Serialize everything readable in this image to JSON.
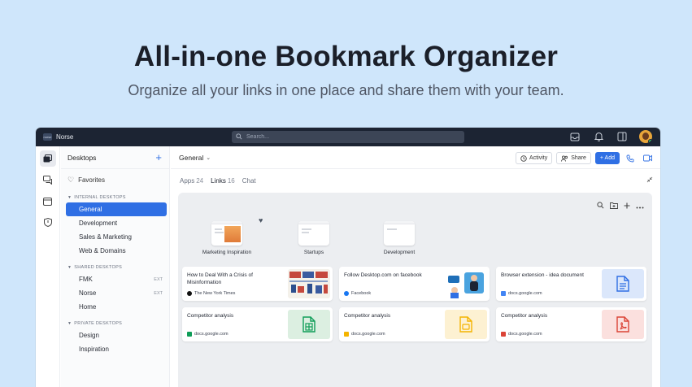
{
  "hero": {
    "title": "All-in-one Bookmark Organizer",
    "subtitle": "Organize all your links in one place and share them with your team."
  },
  "topbar": {
    "brand_logo": "norse",
    "brand": "Norse",
    "search_placeholder": "Search...",
    "icons": [
      "inbox-icon",
      "bell-icon",
      "panel-icon",
      "avatar"
    ]
  },
  "rail": [
    "desktops-icon",
    "chat-icon",
    "calendar-icon",
    "shield-icon"
  ],
  "sidebar": {
    "title": "Desktops",
    "add": "+",
    "favorites": "Favorites",
    "sections": [
      {
        "label": "INTERNAL DESKTOPS",
        "items": [
          {
            "label": "General",
            "active": true
          },
          {
            "label": "Development"
          },
          {
            "label": "Sales & Marketing"
          },
          {
            "label": "Web & Domains"
          }
        ]
      },
      {
        "label": "SHARED DESKTOPS",
        "items": [
          {
            "label": "FMK",
            "badge": "EXT"
          },
          {
            "label": "Norse",
            "badge": "EXT"
          },
          {
            "label": "Home"
          }
        ]
      },
      {
        "label": "PRIVATE DESKTOPS",
        "items": [
          {
            "label": "Design"
          },
          {
            "label": "Inspiration"
          }
        ]
      }
    ]
  },
  "main": {
    "title": "General",
    "actions": {
      "activity": "Activity",
      "share": "Share",
      "add": "+ Add"
    },
    "tabs": [
      {
        "label": "Apps",
        "count": "24"
      },
      {
        "label": "Links",
        "count": "16",
        "active": true
      },
      {
        "label": "Chat",
        "count": ""
      }
    ],
    "folders": [
      "Marketing Inspiration",
      "Startups",
      "Development"
    ],
    "cards": [
      {
        "title": "How to Deal With a Crisis of Misinformation",
        "source": "The New York Times",
        "thumb": "news"
      },
      {
        "title": "Follow Desktop.com on facebook",
        "source": "Facebook",
        "thumb": "facebook"
      },
      {
        "title": "Browser extension - idea document",
        "source": "docs.google.com",
        "thumb": "doc"
      },
      {
        "title": "Competitor analysis",
        "source": "docs.google.com",
        "thumb": "sheet"
      },
      {
        "title": "Competitor analysis",
        "source": "docs.google.com",
        "thumb": "slides"
      },
      {
        "title": "Competitor analysis",
        "source": "docs.google.com",
        "thumb": "pdf"
      }
    ]
  },
  "colors": {
    "accent": "#2f6fe4",
    "topbar": "#1c2433",
    "background": "#cfe6fb"
  }
}
